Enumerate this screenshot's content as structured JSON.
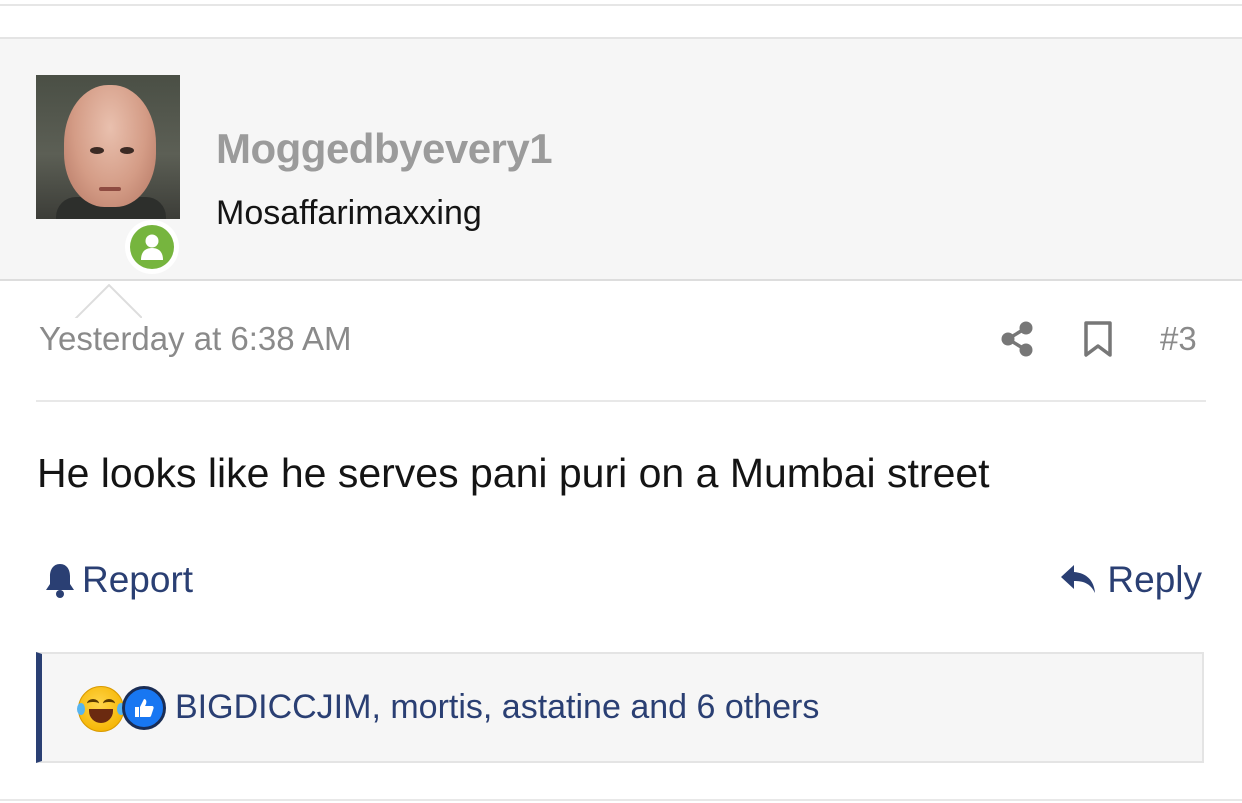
{
  "post": {
    "user": {
      "username": "Moggedbyevery1",
      "title": "Mosaffarimaxxing",
      "online": true
    },
    "date": "Yesterday at 6:38 AM",
    "number": "#3",
    "icons": {
      "share": "share-icon",
      "bookmark": "bookmark-icon"
    },
    "body": "He looks like he serves pani puri on a Mumbai street",
    "actions": {
      "report_label": "Report",
      "reply_label": "Reply"
    },
    "reactions": {
      "icons": [
        "laugh-reaction-icon",
        "like-reaction-icon"
      ],
      "summary": "BIGDICCJIM, mortis, astatine and 6 others"
    }
  },
  "colors": {
    "link": "#2a3f73",
    "muted": "#8a8a8a",
    "online": "#76b53e",
    "header_bg": "#f6f6f6"
  }
}
